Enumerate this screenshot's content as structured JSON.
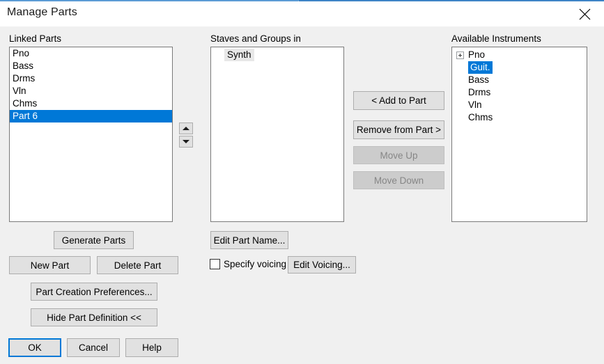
{
  "window": {
    "title": "Manage Parts",
    "close_icon": "close-icon",
    "accent_color": "#0078d7",
    "titlebar_background": "#ffffff",
    "dialog_background": "#f0f0f0"
  },
  "linked_parts": {
    "label": "Linked Parts",
    "items": [
      {
        "label": "Pno",
        "selected": false
      },
      {
        "label": "Bass",
        "selected": false
      },
      {
        "label": "Drms",
        "selected": false
      },
      {
        "label": "Vln",
        "selected": false
      },
      {
        "label": "Chms",
        "selected": false
      },
      {
        "label": "Part 6",
        "selected": true
      }
    ],
    "spinners": {
      "up_icon": "triangle-up-icon",
      "down_icon": "triangle-down-icon"
    },
    "buttons": {
      "generate_parts": "Generate Parts",
      "new_part": "New Part",
      "delete_part": "Delete Part",
      "part_creation_preferences": "Part Creation Preferences...",
      "hide_part_definition": "Hide Part Definition <<"
    }
  },
  "staves_and_groups": {
    "label": "Staves and Groups in",
    "items": [
      {
        "label": "Synth",
        "selected_inactive": true
      }
    ],
    "edit_part_name": "Edit Part Name...",
    "specify_voicing": {
      "label": "Specify voicing",
      "checked": false
    },
    "edit_voicing": "Edit Voicing..."
  },
  "transfer_buttons": [
    {
      "label": "< Add to Part",
      "enabled": true
    },
    {
      "label": "Remove from Part >",
      "enabled": true
    },
    {
      "label": "Move Up",
      "enabled": false
    },
    {
      "label": "Move Down",
      "enabled": false
    }
  ],
  "available_instruments": {
    "label": "Available Instruments",
    "items": [
      {
        "label": "Pno",
        "expandable": true,
        "expander_icon": "plus-box-icon",
        "selected": false
      },
      {
        "label": "Guit.",
        "expandable": false,
        "selected": true
      },
      {
        "label": "Bass",
        "expandable": false,
        "selected": false
      },
      {
        "label": "Drms",
        "expandable": false,
        "selected": false
      },
      {
        "label": "Vln",
        "expandable": false,
        "selected": false
      },
      {
        "label": "Chms",
        "expandable": false,
        "selected": false
      }
    ]
  },
  "footer": {
    "ok": "OK",
    "cancel": "Cancel",
    "help": "Help"
  }
}
